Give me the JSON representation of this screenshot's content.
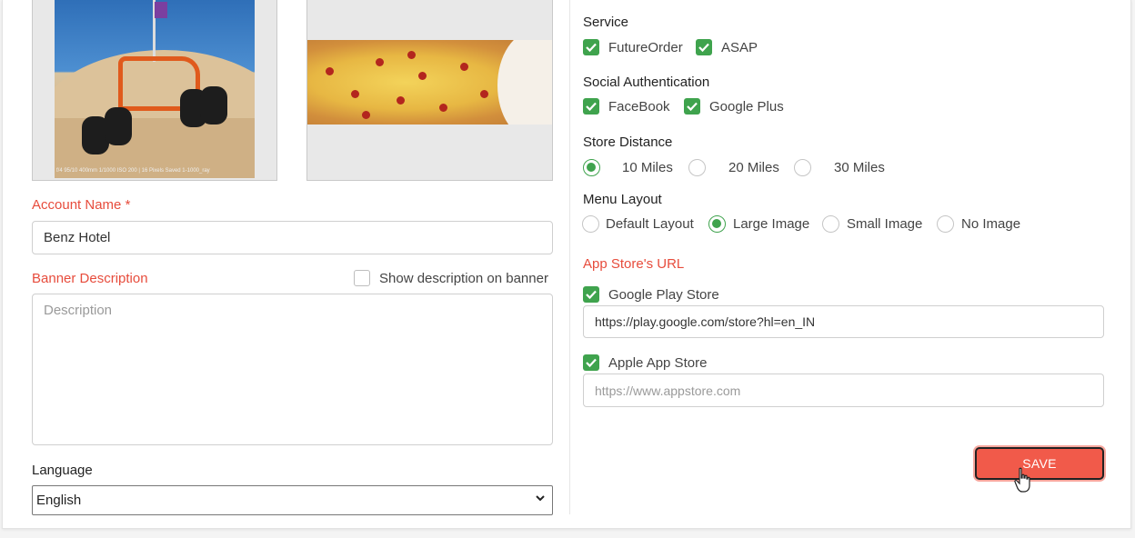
{
  "images": [
    {
      "name": "buggy-photo",
      "caption": "f/4 95/10 400mm 1/1000 ISO 200 | 16 Pixels Saved 1-1000_ray"
    },
    {
      "name": "fries-photo"
    }
  ],
  "account": {
    "label": "Account Name",
    "required_mark": "*",
    "value": "Benz Hotel"
  },
  "banner": {
    "label": "Banner Description",
    "show_on_banner_label": "Show description on banner",
    "placeholder": "Description"
  },
  "language": {
    "label": "Language",
    "selected": "English"
  },
  "service": {
    "title": "Service",
    "options": [
      "FutureOrder",
      "ASAP"
    ]
  },
  "social": {
    "title": "Social Authentication",
    "options": [
      "FaceBook",
      "Google Plus"
    ]
  },
  "store_distance": {
    "title": "Store Distance",
    "options": [
      "10 Miles",
      "20 Miles",
      "30 Miles"
    ],
    "selected": "10 Miles"
  },
  "menu_layout": {
    "title": "Menu Layout",
    "options": [
      "Default Layout",
      "Large Image",
      "Small Image",
      "No Image"
    ],
    "selected": "Large Image"
  },
  "app_store": {
    "title": "App Store's URL",
    "google_label": "Google Play Store",
    "google_url": "https://play.google.com/store?hl=en_IN",
    "apple_label": "Apple App Store",
    "apple_placeholder": "https://www.appstore.com"
  },
  "save_label": "SAVE",
  "colors": {
    "accent_red": "#e74c3c",
    "check_green": "#3fa34d",
    "save_button": "#f15a4a"
  }
}
